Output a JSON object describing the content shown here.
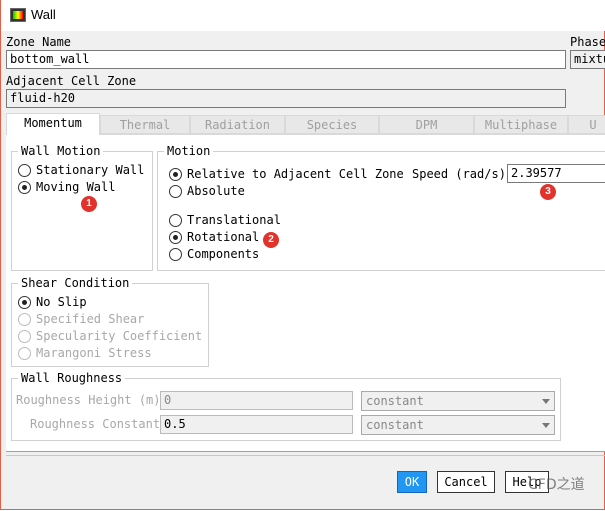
{
  "window": {
    "title": "Wall"
  },
  "zone_name": {
    "label": "Zone Name",
    "value": "bottom_wall"
  },
  "phase": {
    "label": "Phase",
    "value": "mixtu"
  },
  "adjacent": {
    "label": "Adjacent Cell Zone",
    "value": "fluid-h20"
  },
  "tabs": [
    "Momentum",
    "Thermal",
    "Radiation",
    "Species",
    "DPM",
    "Multiphase",
    "U"
  ],
  "wall_motion": {
    "title": "Wall Motion",
    "options": [
      "Stationary Wall",
      "Moving Wall"
    ],
    "selected": "Moving Wall"
  },
  "motion": {
    "title": "Motion",
    "ref_options": [
      "Relative to Adjacent Cell Zone",
      "Absolute"
    ],
    "type_options": [
      "Translational",
      "Rotational",
      "Components"
    ],
    "speed_label": "Speed (rad/s)",
    "speed_value": "2.39577"
  },
  "shear": {
    "title": "Shear Condition",
    "options": [
      "No Slip",
      "Specified Shear",
      "Specularity Coefficient",
      "Marangoni Stress"
    ]
  },
  "roughness": {
    "title": "Wall Roughness",
    "height_label": "Roughness Height (m)",
    "height_value": "0",
    "height_method": "constant",
    "constant_label": "Roughness Constant",
    "constant_value": "0.5",
    "constant_method": "constant"
  },
  "badges": [
    "1",
    "2",
    "3"
  ],
  "buttons": {
    "ok": "OK",
    "cancel": "Cancel",
    "help": "Help"
  },
  "watermark": "CFD之道"
}
